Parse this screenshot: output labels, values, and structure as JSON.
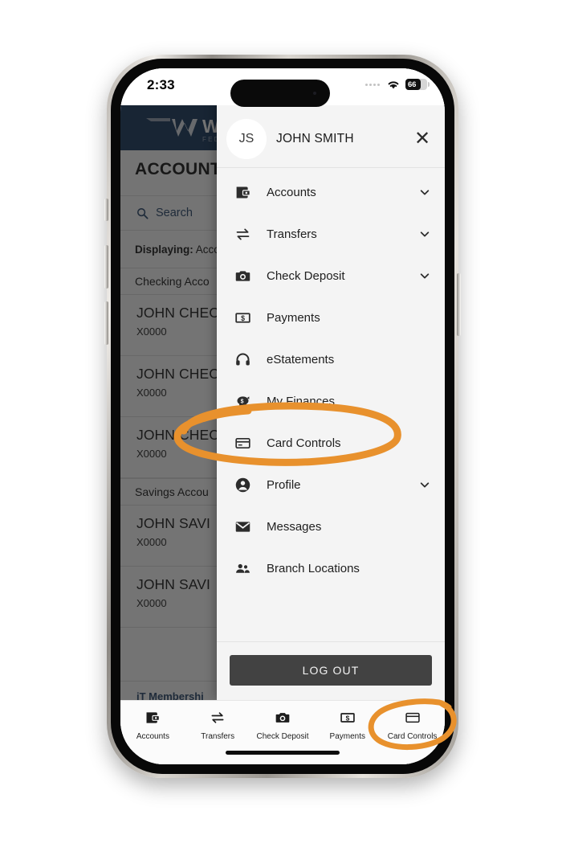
{
  "status_bar": {
    "time": "2:33",
    "battery_percent": "66",
    "wifi_icon": "wifi-icon",
    "signal_icon": "signal-dots-icon"
  },
  "background_app": {
    "brand_name": "WEST",
    "brand_sub": "FEDERAL",
    "brand_color": "#1b3a5f",
    "page_title": "ACCOUNT S",
    "search_placeholder": "Search",
    "search_icon": "search-icon",
    "displaying_label": "Displaying:",
    "displaying_value": "Acco",
    "sections": [
      {
        "header": "Checking Acco",
        "rows": [
          {
            "name": "JOHN CHEC",
            "number": "X0000"
          },
          {
            "name": "JOHN CHEC",
            "number": "X0000"
          },
          {
            "name": "JOHN CHEC",
            "number": "X0000"
          }
        ]
      },
      {
        "header": "Savings Accou",
        "rows": [
          {
            "name": "JOHN SAVI",
            "number": "X0000"
          },
          {
            "name": "JOHN SAVI",
            "number": "X0000"
          }
        ]
      }
    ],
    "footer_link": "iT Membershi"
  },
  "drawer": {
    "user_initials": "JS",
    "user_name": "JOHN SMITH",
    "close_icon": "close-icon",
    "close_glyph": "✕",
    "items": [
      {
        "label": "Accounts",
        "icon": "wallet-icon",
        "expandable": true
      },
      {
        "label": "Transfers",
        "icon": "transfer-arrows-icon",
        "expandable": true
      },
      {
        "label": "Check Deposit",
        "icon": "camera-icon",
        "expandable": true
      },
      {
        "label": "Payments",
        "icon": "dollar-bill-icon",
        "expandable": false
      },
      {
        "label": "eStatements",
        "icon": "headset-icon",
        "expandable": false
      },
      {
        "label": "My Finances",
        "icon": "piggy-bank-icon",
        "expandable": false
      },
      {
        "label": "Card Controls",
        "icon": "credit-card-icon",
        "expandable": false
      },
      {
        "label": "Profile",
        "icon": "person-circle-icon",
        "expandable": true
      },
      {
        "label": "Messages",
        "icon": "envelope-icon",
        "expandable": false
      },
      {
        "label": "Branch Locations",
        "icon": "people-pin-icon",
        "expandable": false
      }
    ],
    "logout_label": "LOG OUT"
  },
  "tab_bar": {
    "tabs": [
      {
        "label": "Accounts",
        "icon": "wallet-icon"
      },
      {
        "label": "Transfers",
        "icon": "transfer-arrows-icon"
      },
      {
        "label": "Check Deposit",
        "icon": "camera-icon"
      },
      {
        "label": "Payments",
        "icon": "dollar-bill-icon"
      },
      {
        "label": "Card Controls",
        "icon": "credit-card-icon"
      }
    ]
  },
  "annotations": {
    "color": "#e8912d",
    "highlights": [
      {
        "target": "Card Controls",
        "location": "drawer-menu-item"
      },
      {
        "target": "Card Controls",
        "location": "bottom-tab"
      }
    ]
  }
}
